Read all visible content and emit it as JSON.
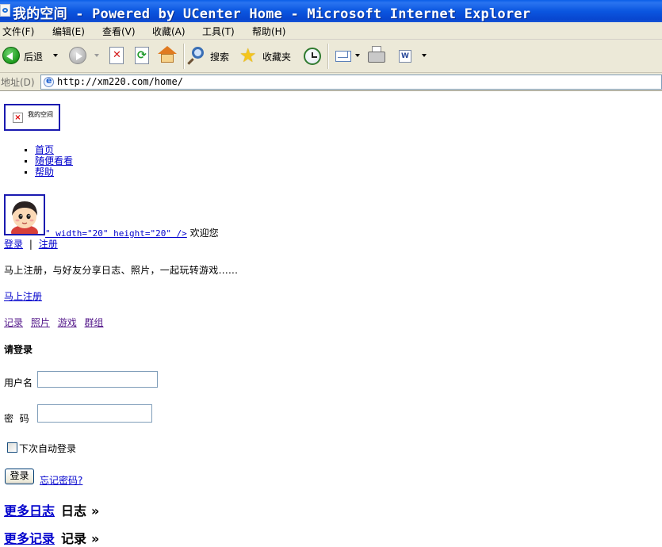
{
  "window": {
    "title": "我的空间 - Powered by UCenter Home - Microsoft Internet Explorer",
    "title_bar_color": "#0b56e0"
  },
  "menubar": {
    "items": [
      {
        "label": "文件(F)"
      },
      {
        "label": "编辑(E)"
      },
      {
        "label": "查看(V)"
      },
      {
        "label": "收藏(A)"
      },
      {
        "label": "工具(T)"
      },
      {
        "label": "帮助(H)"
      }
    ]
  },
  "toolbar": {
    "back_label": "后退",
    "search_label": "搜索",
    "favorites_label": "收藏夹",
    "icons": [
      "back-icon",
      "forward-icon",
      "stop-icon",
      "refresh-icon",
      "home-icon",
      "search-icon",
      "favorites-star-icon",
      "history-icon",
      "mail-icon",
      "print-icon",
      "word-icon"
    ]
  },
  "address": {
    "label": "地址(D)",
    "url": "http://xm220.com/home/"
  },
  "page": {
    "logo_alt": "我的空间",
    "nav": [
      {
        "label": "首页"
      },
      {
        "label": "随便看看"
      },
      {
        "label": "帮助"
      }
    ],
    "welcome": {
      "broken_markup": "\" width=\"20\" height=\"20\" />",
      "text": "欢迎您"
    },
    "auth": {
      "login": "登录",
      "separator": "|",
      "register": "注册"
    },
    "intro_text": "马上注册，与好友分享日志、照片，一起玩转游戏......",
    "register_now": "马上注册",
    "features": [
      {
        "label": "记录"
      },
      {
        "label": "照片"
      },
      {
        "label": "游戏"
      },
      {
        "label": "群组"
      }
    ],
    "login_form": {
      "heading": "请登录",
      "username_label": "用户名",
      "username_value": "",
      "password_label": "密  码",
      "password_value": "",
      "remember_label": "下次自动登录",
      "remember_checked": false,
      "submit_label": "登录",
      "forgot_label": "忘记密码?"
    },
    "sections": [
      {
        "more": "更多日志",
        "label": "日志",
        "arrow": "»"
      },
      {
        "more": "更多记录",
        "label": "记录",
        "arrow": "»"
      }
    ]
  },
  "colors": {
    "link": "#0000cc",
    "visited_link": "#551a8b",
    "chrome_bg": "#ece9d8"
  }
}
